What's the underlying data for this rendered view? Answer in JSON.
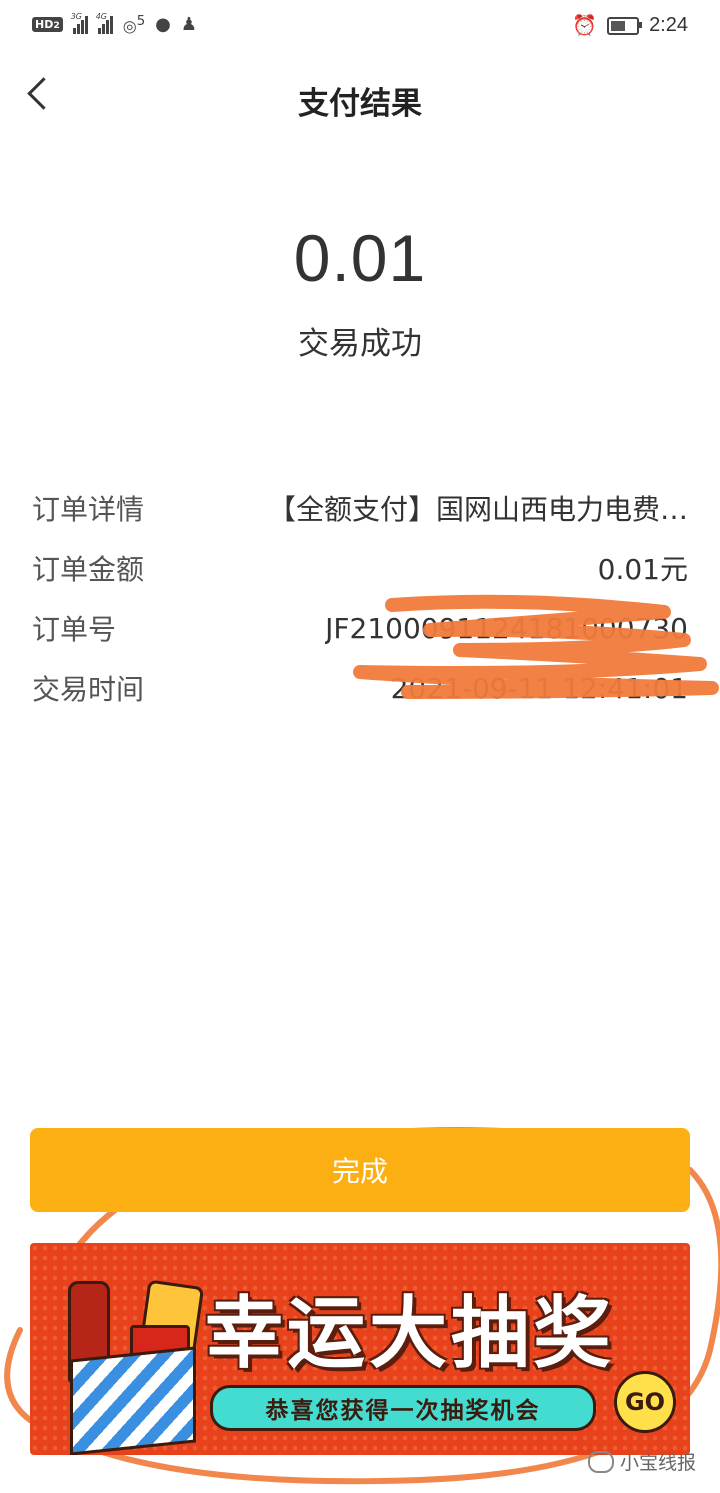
{
  "status_bar": {
    "hd": "HD",
    "hd_sub": "2",
    "sig1_tag": "3G",
    "sig2_tag": "4G",
    "hotspot_count": "5",
    "time": "2:24"
  },
  "nav": {
    "title": "支付结果"
  },
  "result": {
    "amount": "0.01",
    "status": "交易成功"
  },
  "details": [
    {
      "label": "订单详情",
      "value": "【全额支付】国网山西电力电费…"
    },
    {
      "label": "订单金额",
      "value": "0.01元"
    },
    {
      "label": "订单号",
      "value": "JF2100091124181000730"
    },
    {
      "label": "交易时间",
      "value": "2021-09-11 12:41:01"
    }
  ],
  "done_button": "完成",
  "banner": {
    "title": "幸运大抽奖",
    "subtitle": "恭喜您获得一次抽奖机会",
    "go": "GO"
  },
  "watermark": "小宝线报",
  "colors": {
    "accent": "#fbaf13",
    "banner_bg": "#e8421c",
    "annotation": "#f07a3a"
  },
  "icons": [
    "back-arrow-icon",
    "alarm-icon",
    "battery-icon",
    "wechat-icon",
    "qq-icon",
    "signal-icon",
    "hotspot-icon"
  ]
}
